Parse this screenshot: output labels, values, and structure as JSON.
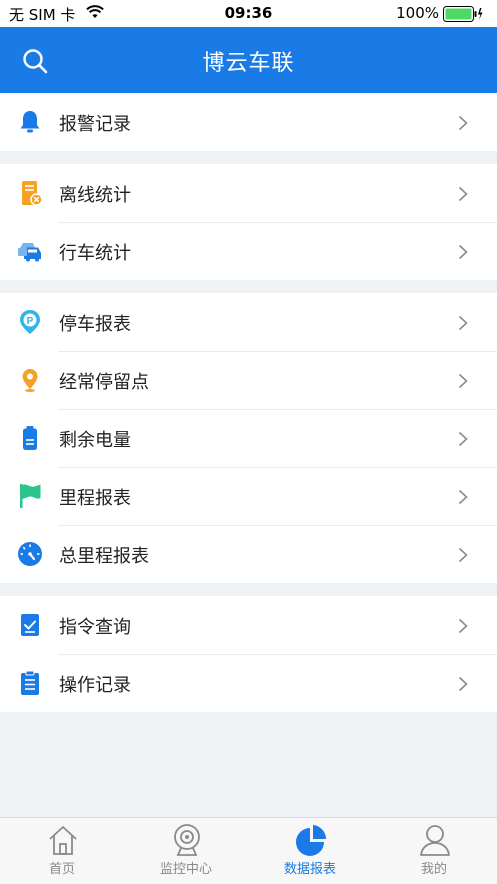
{
  "status_bar": {
    "carrier": "无 SIM 卡",
    "time": "09:36",
    "battery": "100%"
  },
  "nav": {
    "title": "博云车联",
    "search_icon": "search-icon"
  },
  "menu": {
    "group1": [
      {
        "label": "报警记录",
        "icon": "bell-icon"
      }
    ],
    "group2": [
      {
        "label": "离线统计",
        "icon": "offline-device-icon"
      },
      {
        "label": "行车统计",
        "icon": "cars-icon"
      }
    ],
    "group3": [
      {
        "label": "停车报表",
        "icon": "parking-pin-icon"
      },
      {
        "label": "经常停留点",
        "icon": "location-pin-icon"
      },
      {
        "label": "剩余电量",
        "icon": "battery-icon"
      },
      {
        "label": "里程报表",
        "icon": "flag-icon"
      },
      {
        "label": "总里程报表",
        "icon": "speedometer-icon"
      }
    ],
    "group4": [
      {
        "label": "指令查询",
        "icon": "checklist-icon"
      },
      {
        "label": "操作记录",
        "icon": "clipboard-icon"
      }
    ]
  },
  "tabs": [
    {
      "label": "首页",
      "icon": "home-icon"
    },
    {
      "label": "监控中心",
      "icon": "camera-icon"
    },
    {
      "label": "数据报表",
      "icon": "pie-chart-icon",
      "active": true
    },
    {
      "label": "我的",
      "icon": "user-icon"
    }
  ],
  "colors": {
    "primary": "#1a7ae6",
    "orange": "#f4a227",
    "green": "#2bc48a",
    "battery_green": "#4cd964"
  }
}
